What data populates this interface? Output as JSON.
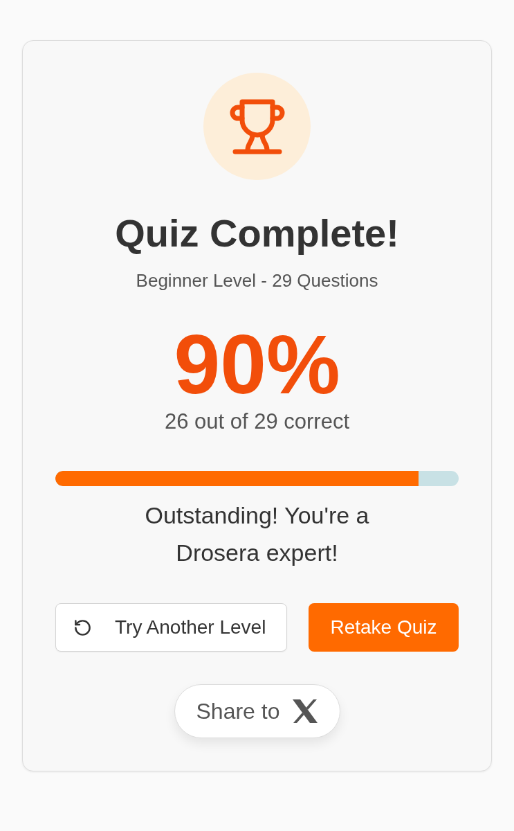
{
  "result": {
    "title": "Quiz Complete!",
    "subtitle": "Beginner Level - 29 Questions",
    "score": "90%",
    "detail": "26 out of 29 correct"
  },
  "progress": {
    "level": 0.9
  },
  "message": "Outstanding! You're a Drosera expert!",
  "buttons": [
    {
      "kind": "outline",
      "label": "Try Another Level"
    },
    {
      "kind": "primary",
      "label": "Retake Quiz"
    }
  ],
  "share": {
    "label": "Share to"
  }
}
